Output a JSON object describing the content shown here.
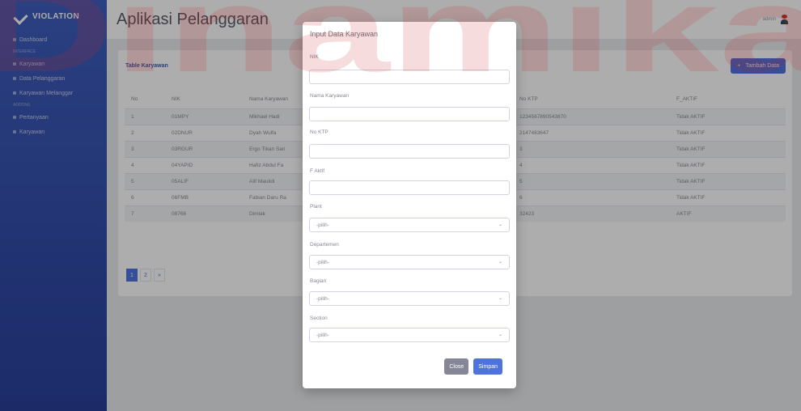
{
  "sidebar": {
    "brand": "VIOLATION",
    "items": [
      {
        "type": "item",
        "label": "Dashboard"
      },
      {
        "type": "head",
        "label": "INTERFACE"
      },
      {
        "type": "item",
        "label": "Karyawan"
      },
      {
        "type": "item",
        "label": "Data Pelanggaran"
      },
      {
        "type": "item",
        "label": "Karyawan Melanggar"
      },
      {
        "type": "head",
        "label": "ADDONS"
      },
      {
        "type": "item",
        "label": "Pertanyaan"
      },
      {
        "type": "item",
        "label": "Karyawan"
      }
    ]
  },
  "header": {
    "title": "Aplikasi Pelanggaran",
    "user_name": "admin"
  },
  "card": {
    "title": "Table Karyawan",
    "add_button": "Tambah Data",
    "columns": [
      "No",
      "NIK",
      "Nama Karyawan",
      "No KTP",
      "F_AKTIF"
    ],
    "rows": [
      [
        "1",
        "01MPY",
        "Mikhael Hadi",
        "1234567890543870",
        "Tidak AKTIF"
      ],
      [
        "2",
        "02DNUR",
        "Dyah Wulfa",
        "2147483647",
        "Tidak AKTIF"
      ],
      [
        "3",
        "03RGUR",
        "Ergo Tikan Sari",
        "3",
        "Tidak AKTIF"
      ],
      [
        "4",
        "04YAPID",
        "Hafiz Abdul Fa",
        "4",
        "Tidak AKTIF"
      ],
      [
        "5",
        "05ALIF",
        "Alif Maulidi",
        "5",
        "Tidak AKTIF"
      ],
      [
        "6",
        "06FMB",
        "Fabian Daru Ra",
        "6",
        "Tidak AKTIF"
      ],
      [
        "7",
        "08766",
        "Dimlak",
        "32423",
        "AKTIF"
      ]
    ],
    "pages": [
      "1",
      "2",
      "»"
    ]
  },
  "modal": {
    "title": "Input Data Karyawan",
    "fields": [
      {
        "label": "NIK",
        "value": "",
        "kind": "text"
      },
      {
        "label": "Nama Karyawan",
        "value": "",
        "kind": "text"
      },
      {
        "label": "No KTP",
        "value": "",
        "kind": "text"
      },
      {
        "label": "F Aktif",
        "value": "",
        "kind": "text"
      },
      {
        "label": "Plant",
        "value": "-pilih-",
        "kind": "select"
      },
      {
        "label": "Departemen",
        "value": "-pilih-",
        "kind": "select"
      },
      {
        "label": "Bagian",
        "value": "-pilih-",
        "kind": "select"
      },
      {
        "label": "Section",
        "value": "-pilih-",
        "kind": "select"
      }
    ],
    "close_label": "Close",
    "save_label": "Simpan"
  },
  "watermark": "Dinamika",
  "colors": {
    "primary": "#4e73df",
    "sidebar": "#3f5fbf",
    "watermark": "#c62828"
  }
}
